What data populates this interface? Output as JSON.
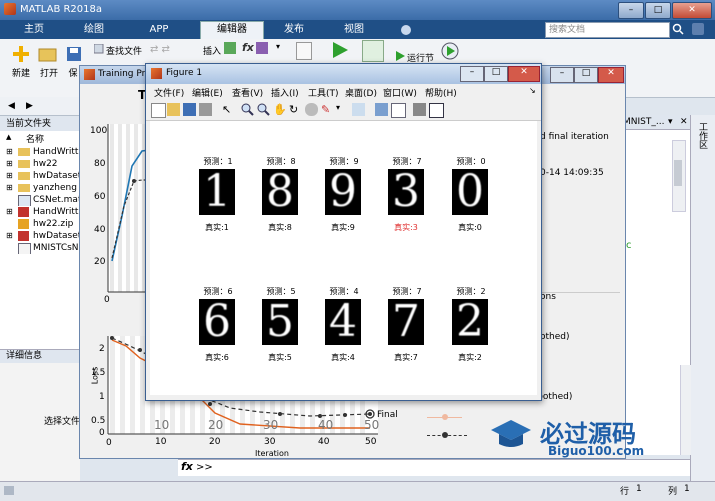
{
  "app": {
    "title": "MATLAB R2018a",
    "search_placeholder": "搜索文档"
  },
  "ribbon_tabs": [
    "主页",
    "绘图",
    "APP",
    "编辑器",
    "发布",
    "视图"
  ],
  "ribbon_tab_active": "编辑器",
  "ribbon_buttons": {
    "new": "新建",
    "open": "打开",
    "save": "保",
    "find_files": "查找文件",
    "insert": "插入",
    "fx": "fx",
    "run_section": "运行节"
  },
  "left_panel": {
    "current_folder": "当前文件夹",
    "name_header": "名称",
    "files": [
      "HandWritte",
      "hw22",
      "hwDataset",
      "yanzheng",
      "CSNet.mat",
      "HandWritte",
      "hw22.zip",
      "hwDataset.",
      "MNISTCsN"
    ],
    "details_header": "详细信息",
    "select_hint": "选择文件"
  },
  "training_window": {
    "title": "Training Pro",
    "title_fragment": "Tr",
    "loss_axis_label": "Loss",
    "iteration_label": "Iteration",
    "final_label": "Final",
    "epoch_ticks": [
      "10",
      "20",
      "30",
      "40",
      "50"
    ],
    "acc_yticks": [
      "100",
      "80",
      "60",
      "40",
      "20",
      "0"
    ],
    "loss_yticks": [
      "2",
      "1.5",
      "1",
      "0.5",
      "0"
    ],
    "loss_xticks": [
      "0",
      "10",
      "20",
      "30",
      "40",
      "50"
    ]
  },
  "right_panel": {
    "text_final_iteration": "d final iteration",
    "timestamp": "0-14 14:09:35",
    "options": "ons",
    "smoothed": "othed)",
    "training_smoothed": "Training (smoothed)",
    "tab_label": "MNIST_...",
    "workspace_label": "工作区"
  },
  "figure": {
    "title": "Figure 1",
    "menu": [
      "文件(F)",
      "编辑(E)",
      "查看(V)",
      "插入(I)",
      "工具(T)",
      "桌面(D)",
      "窗口(W)",
      "帮助(H)"
    ],
    "samples": [
      {
        "pred": "预测：1",
        "truth": "真实:1",
        "digit": "1",
        "error": false
      },
      {
        "pred": "预测：8",
        "truth": "真实:8",
        "digit": "8",
        "error": false
      },
      {
        "pred": "预测：9",
        "truth": "真实:9",
        "digit": "9",
        "error": false
      },
      {
        "pred": "预测：7",
        "truth": "真实:3",
        "digit": "3",
        "error": true
      },
      {
        "pred": "预测：0",
        "truth": "真实:0",
        "digit": "0",
        "error": false
      },
      {
        "pred": "预测：6",
        "truth": "真实:6",
        "digit": "6",
        "error": false
      },
      {
        "pred": "预测：5",
        "truth": "真实:5",
        "digit": "5",
        "error": false
      },
      {
        "pred": "预测：4",
        "truth": "真实:4",
        "digit": "4",
        "error": false
      },
      {
        "pred": "预测：7",
        "truth": "真实:7",
        "digit": "7",
        "error": false
      },
      {
        "pred": "预测：2",
        "truth": "真实:2",
        "digit": "2",
        "error": false
      }
    ]
  },
  "command": {
    "fx": "fx",
    "prompt": ">>"
  },
  "status": {
    "row_label": "行",
    "row_value": "1",
    "col_label": "列",
    "col_value": "1"
  },
  "watermark": {
    "text": "必过源码",
    "url": "Biguo100.com"
  },
  "colors": {
    "ribbon_bg": "#1f4f86",
    "acc_line": "#1f77b4",
    "loss_line": "#e0621f",
    "error_text": "#e03030"
  }
}
